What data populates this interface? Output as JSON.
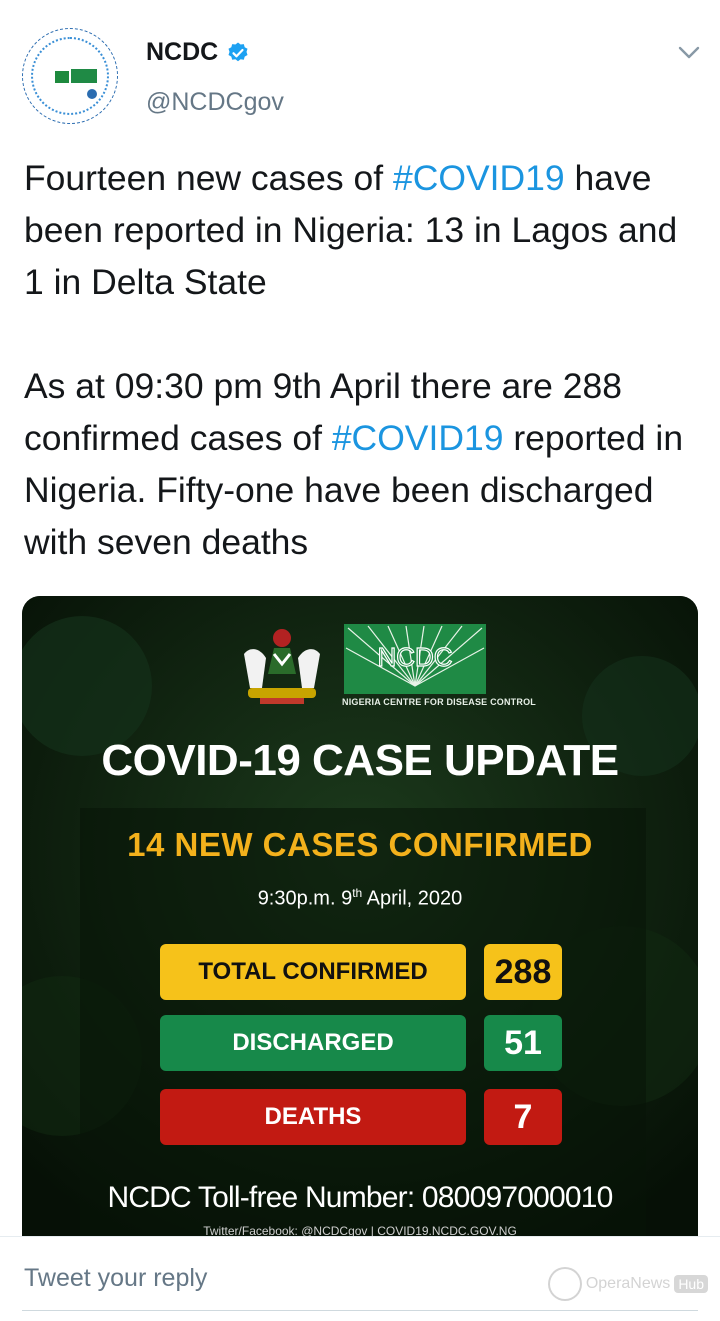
{
  "tweet": {
    "author_name": "NCDC",
    "author_handle": "@NCDCgov",
    "text": {
      "p1_part1": "Fourteen new cases of ",
      "p1_hashtag": "#COVID19",
      "p1_part2": " have been reported in Nigeria: 13 in Lagos and 1 in Delta State",
      "p2_part1": "As at 09:30 pm 9th April there are 288 confirmed cases of ",
      "p2_hashtag": "#COVID19",
      "p2_part2": " reported in Nigeria. Fifty-one have been discharged with seven deaths"
    }
  },
  "media": {
    "logo_text": "NCDC",
    "logo_subtitle": "NIGERIA CENTRE FOR DISEASE CONTROL",
    "headline": "COVID-19 CASE UPDATE",
    "new_cases": "14 NEW CASES CONFIRMED",
    "timestamp_pre": "9:30p.m. 9",
    "timestamp_sup": "th",
    "timestamp_post": " April, 2020",
    "stats": {
      "total_label": "TOTAL CONFIRMED",
      "total_value": "288",
      "discharged_label": "DISCHARGED",
      "discharged_value": "51",
      "deaths_label": "DEATHS",
      "deaths_value": "7"
    },
    "tollfree": "NCDC Toll-free Number: 080097000010",
    "social": "Twitter/Facebook: @NCDCgov | COVID19.NCDC.GOV.NG"
  },
  "reply": {
    "placeholder": "Tweet your reply"
  },
  "watermark": {
    "text": "OperaNews",
    "badge": "Hub"
  },
  "colors": {
    "hashtag": "#1b95e0",
    "verified": "#1da1f2",
    "total": "#f6c21a",
    "discharged": "#17894a",
    "deaths": "#c21a12",
    "headline_accent": "#f3b11c"
  },
  "icons": [
    "verified-badge-icon",
    "chevron-down-icon",
    "crest-icon",
    "ncdc-logo-icon",
    "opera-news-icon"
  ]
}
